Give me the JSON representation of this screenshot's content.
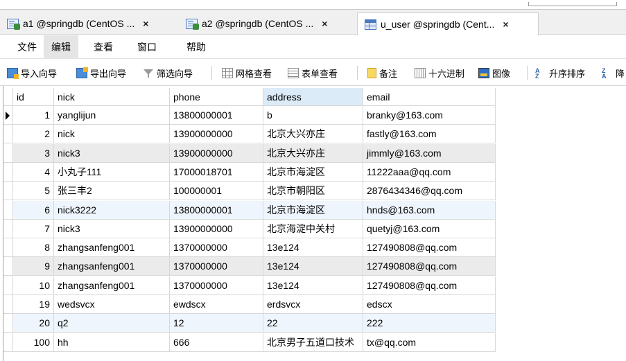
{
  "tabs": [
    {
      "label": "a1 @springdb (CentOS ...",
      "close": "×",
      "icon": "query-icon"
    },
    {
      "label": "a2 @springdb (CentOS ...",
      "close": "×",
      "icon": "query-icon"
    },
    {
      "label": "u_user @springdb (Cent...",
      "close": "×",
      "icon": "table-icon"
    }
  ],
  "menu": [
    "文件",
    "编辑",
    "查看",
    "窗口",
    "帮助"
  ],
  "toolbar": {
    "import": "导入向导",
    "export": "导出向导",
    "filter": "筛选向导",
    "grid_view": "网格查看",
    "form_view": "表单查看",
    "memo": "备注",
    "hex": "十六进制",
    "image": "图像",
    "sort_asc": "升序排序",
    "sort_desc_partial": "降"
  },
  "table": {
    "columns": [
      "id",
      "nick",
      "phone",
      "address",
      "email"
    ],
    "rows": [
      {
        "id": "1",
        "nick": "yanglijun",
        "phone": "13800000001",
        "address": "b",
        "email": "branky@163.com"
      },
      {
        "id": "2",
        "nick": "nick",
        "phone": "13900000000",
        "address": "北京大兴亦庄",
        "email": "fastly@163.com"
      },
      {
        "id": "3",
        "nick": "nick3",
        "phone": "13900000000",
        "address": "北京大兴亦庄",
        "email": "jimmly@163.com"
      },
      {
        "id": "4",
        "nick": "小丸子111",
        "phone": "17000018701",
        "address": "北京市海淀区",
        "email": "11222aaa@qq.com"
      },
      {
        "id": "5",
        "nick": "张三丰2",
        "phone": "100000001",
        "address": "北京市朝阳区",
        "email": "2876434346@qq.com"
      },
      {
        "id": "6",
        "nick": "nick3222",
        "phone": "13800000001",
        "address": "北京市海淀区",
        "email": "hnds@163.com"
      },
      {
        "id": "7",
        "nick": "nick3",
        "phone": "13900000000",
        "address": "北京海淀中关村",
        "email": "quetyj@163.com"
      },
      {
        "id": "8",
        "nick": "zhangsanfeng001",
        "phone": "1370000000",
        "address": "13e124",
        "email": "127490808@qq.com"
      },
      {
        "id": "9",
        "nick": "zhangsanfeng001",
        "phone": "1370000000",
        "address": "13e124",
        "email": "127490808@qq.com"
      },
      {
        "id": "10",
        "nick": "zhangsanfeng001",
        "phone": "1370000000",
        "address": "13e124",
        "email": "127490808@qq.com"
      },
      {
        "id": "19",
        "nick": "wedsvcx",
        "phone": "ewdscx",
        "address": "erdsvcx",
        "email": "edscx"
      },
      {
        "id": "20",
        "nick": "q2",
        "phone": "12",
        "address": "22",
        "email": "222"
      },
      {
        "id": "100",
        "nick": "hh",
        "phone": "666",
        "address": "北京男子五道口技术",
        "email": "tx@qq.com"
      }
    ],
    "selected_column": "address",
    "current_row": 0
  },
  "colors": {
    "selected_header": "#dcebf8",
    "alt_row": "#ebebeb",
    "selected_row": "#eef5fd"
  }
}
